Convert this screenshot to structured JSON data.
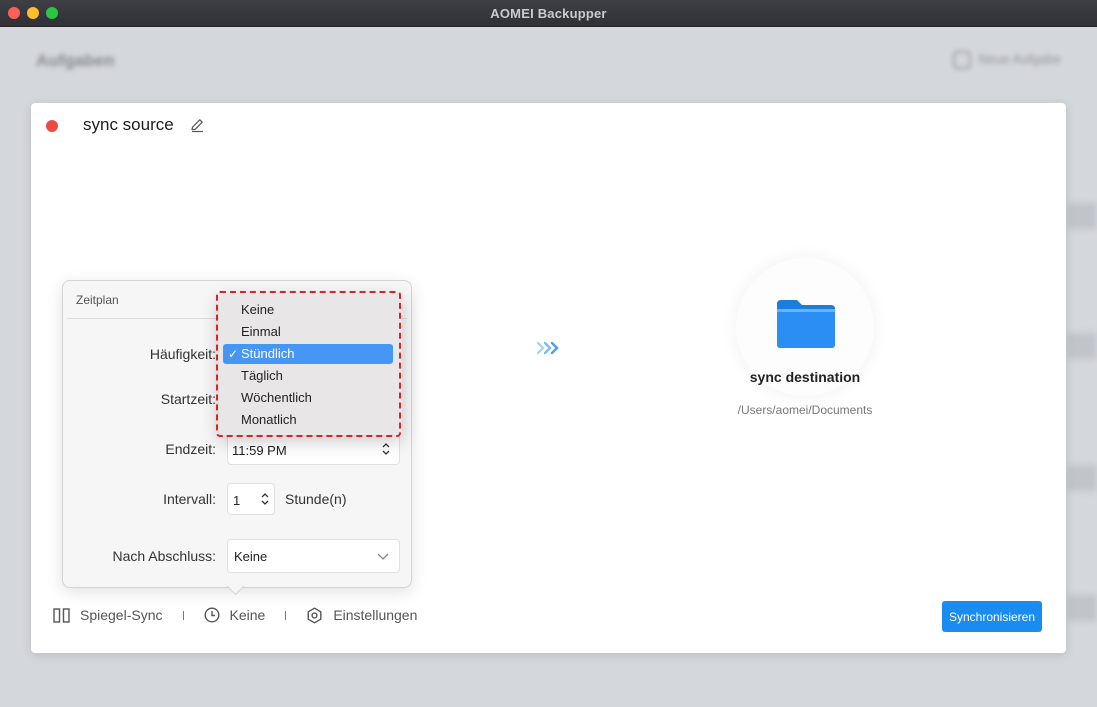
{
  "window": {
    "title": "AOMEI Backupper"
  },
  "background": {
    "heading": "Aufgaben",
    "new_task": "Neue Aufgabe"
  },
  "task": {
    "name": "sync source",
    "destination_name": "sync destination",
    "destination_path": "/Users/aomei/Documents"
  },
  "schedule": {
    "heading": "Zeitplan",
    "frequency_label": "Häufigkeit:",
    "start_label": "Startzeit:",
    "end_label": "Endzeit:",
    "end_value": "11:59 PM",
    "interval_label": "Intervall:",
    "interval_value": "1",
    "interval_unit": "Stunde(n)",
    "after_label": "Nach Abschluss:",
    "after_value": "Keine"
  },
  "frequency_menu": {
    "items": [
      "Keine",
      "Einmal",
      "Stündlich",
      "Täglich",
      "Wöchentlich",
      "Monatlich"
    ],
    "selected": "Stündlich",
    "check_mark": "✓"
  },
  "bottom_bar": {
    "mode": "Spiegel-Sync",
    "schedule": "Keine",
    "settings": "Einstellungen"
  },
  "sync_button": "Synchronisieren",
  "colors": {
    "accent": "#1a8cf0",
    "menu_selection": "#4596f5",
    "highlight_border": "#d8232a",
    "status_dot": "#ea4b43"
  }
}
